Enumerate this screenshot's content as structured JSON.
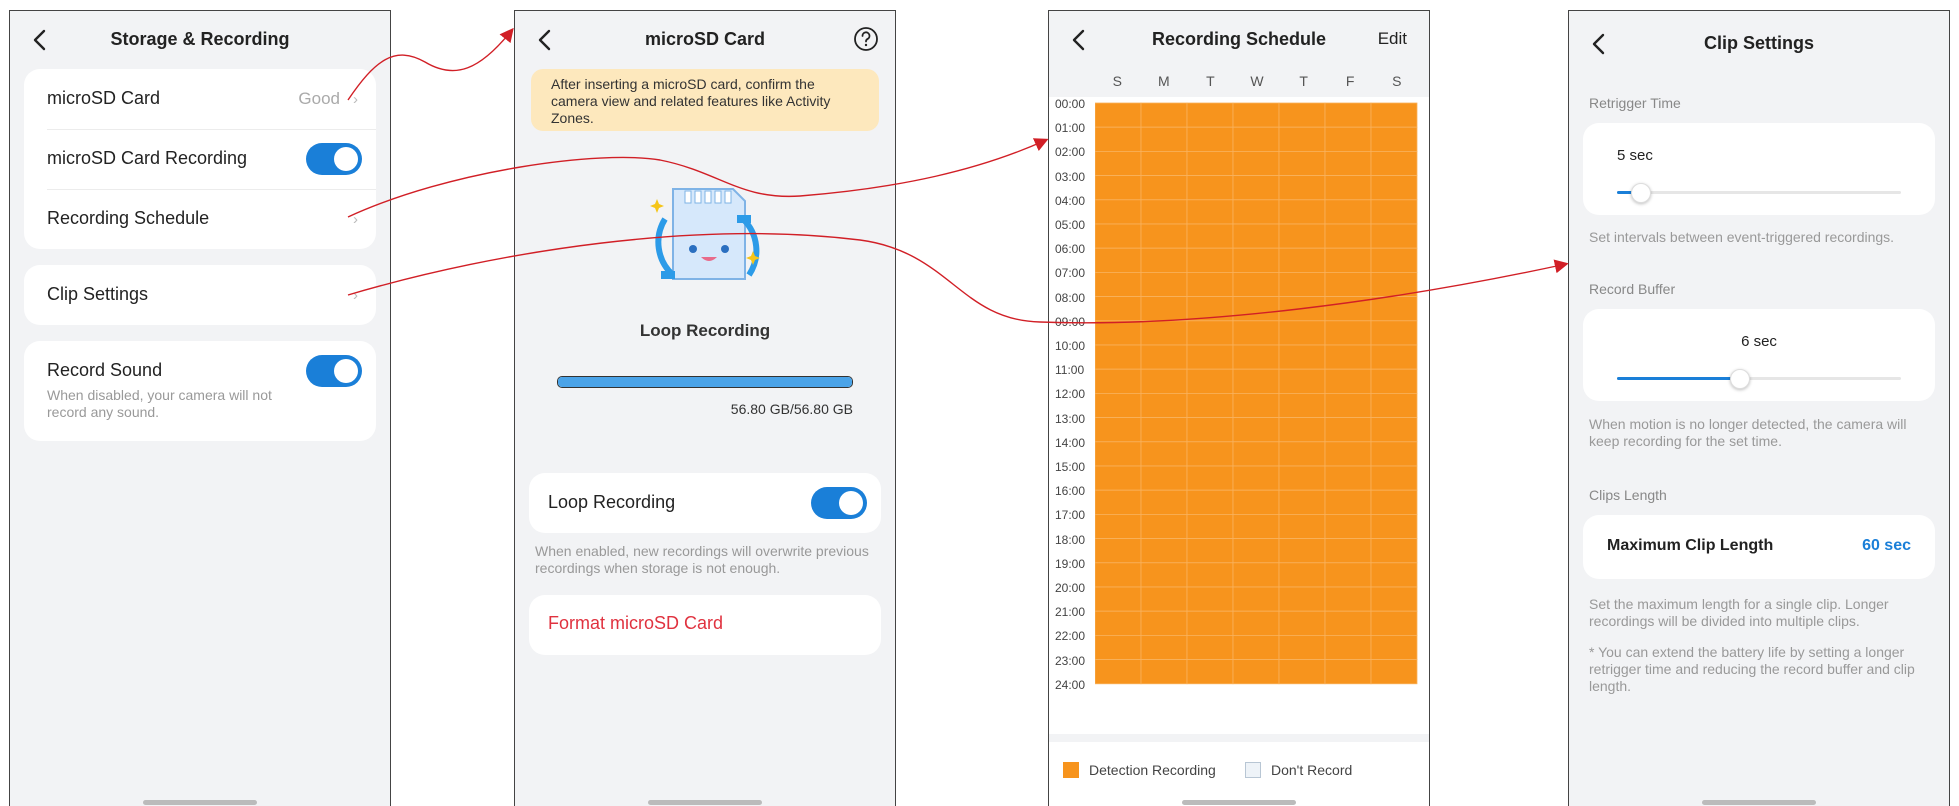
{
  "panel1": {
    "title": "Storage & Recording",
    "microsd_label": "microSD Card",
    "microsd_status": "Good",
    "microsd_recording_label": "microSD Card Recording",
    "microsd_recording_on": true,
    "schedule_label": "Recording Schedule",
    "clip_label": "Clip Settings",
    "sound_label": "Record Sound",
    "sound_on": true,
    "sound_desc": "When disabled, your camera will not record any sound."
  },
  "panel2": {
    "title": "microSD Card",
    "notice": "After inserting a microSD card, confirm the camera view and related features like Activity Zones.",
    "loop_title": "Loop Recording",
    "storage_used_fraction": 1.0,
    "storage_text": "56.80 GB/56.80 GB",
    "loop_toggle_label": "Loop Recording",
    "loop_on": true,
    "loop_desc": "When enabled, new recordings will overwrite previous recordings when storage is not enough.",
    "format_label": "Format microSD Card"
  },
  "panel3": {
    "title": "Recording Schedule",
    "edit_label": "Edit",
    "days": [
      "S",
      "M",
      "T",
      "W",
      "T",
      "F",
      "S"
    ],
    "times": [
      "00:00",
      "01:00",
      "02:00",
      "03:00",
      "04:00",
      "05:00",
      "06:00",
      "07:00",
      "08:00",
      "09:00",
      "10:00",
      "11:00",
      "12:00",
      "13:00",
      "14:00",
      "15:00",
      "16:00",
      "17:00",
      "18:00",
      "19:00",
      "20:00",
      "21:00",
      "22:00",
      "23:00",
      "24:00"
    ],
    "legend_detection": "Detection Recording",
    "legend_none": "Don't Record",
    "detection_color": "#f7941d",
    "none_color": "#eef3f8"
  },
  "panel4": {
    "title": "Clip Settings",
    "retrigger_label": "Retrigger Time",
    "retrigger_value": "5 sec",
    "retrigger_fraction": 0.08,
    "retrigger_desc": "Set intervals between event-triggered recordings.",
    "buffer_label": "Record Buffer",
    "buffer_value": "6 sec",
    "buffer_fraction": 0.43,
    "buffer_desc": "When motion is no longer detected, the camera will keep recording for the set time.",
    "clips_length_label": "Clips Length",
    "max_clip_label": "Maximum Clip Length",
    "max_clip_value": "60 sec",
    "clips_desc": "Set the maximum length for a single clip. Longer recordings will be divided into multiple clips.",
    "battery_note": "* You can extend the battery life by setting a longer retrigger time and reducing the record buffer and clip length."
  },
  "colors": {
    "accent": "#1a7fd8",
    "danger": "#e0323f",
    "notice_bg": "#fde8bd",
    "arrow": "#d11f26"
  }
}
